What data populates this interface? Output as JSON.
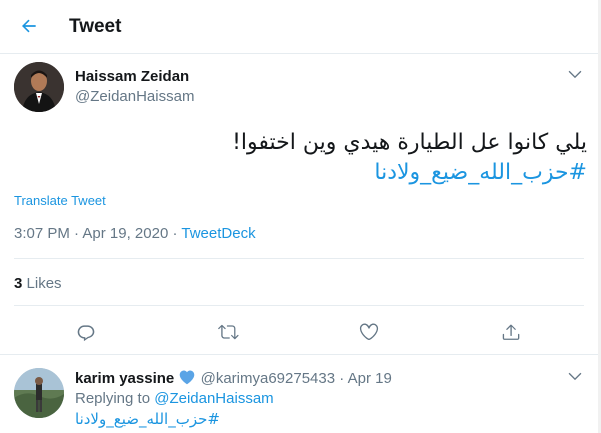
{
  "header": {
    "title": "Tweet"
  },
  "tweet": {
    "author_name": "Haissam Zeidan",
    "author_handle": "@ZeidanHaissam",
    "text": "يلي كانوا عل الطيارة هيدي وين اختفوا!",
    "hashtag": "#حزب_الله_ضيع_ولادنا",
    "translate_label": "Translate Tweet",
    "time": "3:07 PM",
    "date": "Apr 19, 2020",
    "separator": "·",
    "source": "TweetDeck",
    "likes_count": "3",
    "likes_label": "Likes"
  },
  "reply": {
    "author_name": "karim yassine",
    "author_handle": "@karimya69275433",
    "separator": "·",
    "date": "Apr 19",
    "replying_to_prefix": "Replying to ",
    "replying_to_handle": "@ZeidanHaissam",
    "hashtag": "#حزب_الله_ضيع_ولادنا"
  },
  "icons": {
    "back": "arrow-left-icon",
    "menu": "chevron-down-icon",
    "reply": "comment-icon",
    "retweet": "retweet-icon",
    "like": "heart-icon",
    "share": "share-icon",
    "verified_heart": "blue-heart-icon"
  },
  "colors": {
    "accent": "#1b95e0",
    "text": "#14171a",
    "secondary": "#657786",
    "divider": "#e6ecf0"
  }
}
